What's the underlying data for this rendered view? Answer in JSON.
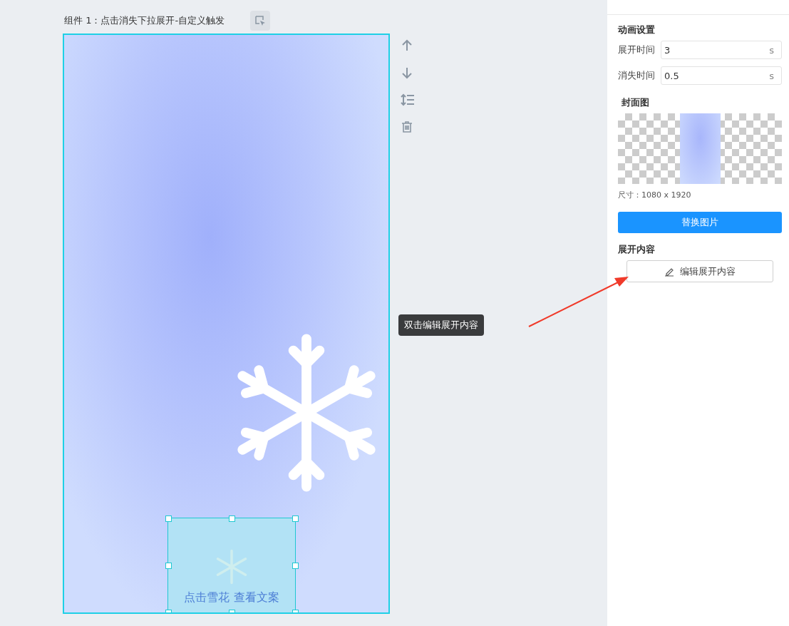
{
  "canvas": {
    "component_title": "组件 1：点击消失下拉展开-自定义触发",
    "selected_component": {
      "caption": "点击雪花 查看文案"
    },
    "tooltip": "双击编辑展开内容"
  },
  "panel": {
    "animation": {
      "heading": "动画设置",
      "fields": [
        {
          "label": "展开时间",
          "value": "3",
          "unit": "s"
        },
        {
          "label": "消失时间",
          "value": "0.5",
          "unit": "s"
        }
      ]
    },
    "cover": {
      "heading": "封面图",
      "size": "尺寸：1080 x 1920",
      "button": "替换图片"
    },
    "expand": {
      "heading": "展开内容",
      "button": "编辑展开内容"
    }
  }
}
